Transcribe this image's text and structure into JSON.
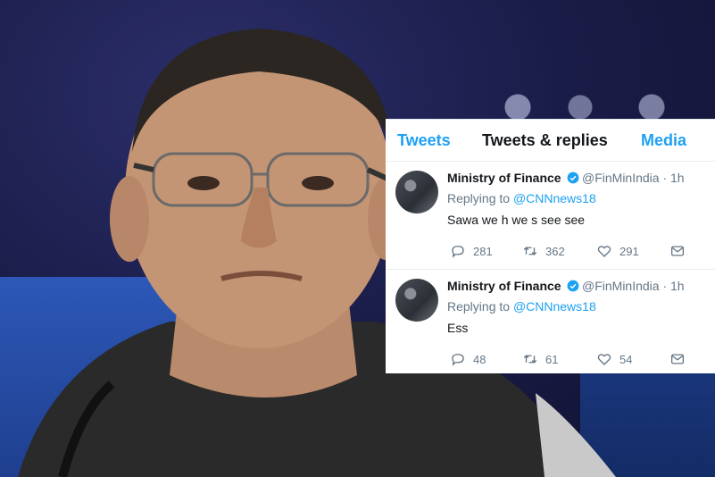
{
  "profile": {
    "tabs": [
      {
        "label": "Tweets"
      },
      {
        "label": "Tweets & replies"
      },
      {
        "label": "Media"
      }
    ],
    "tweets": [
      {
        "author_name": "Ministry of Finance",
        "handle_time": "@FinMinIndia · 1h",
        "replying_prefix": "Replying to",
        "replying_to": "@CNNnews18",
        "text": "Sawa we h we s see see",
        "replies": "281",
        "retweets": "362",
        "likes": "291"
      },
      {
        "author_name": "Ministry of Finance",
        "handle_time": "@FinMinIndia · 1h",
        "replying_prefix": "Replying to",
        "replying_to": "@CNNnews18",
        "text": "Ess",
        "replies": "48",
        "retweets": "61",
        "likes": "54"
      }
    ]
  },
  "colors": {
    "link_blue": "#1da1f2",
    "text_dark": "#14171a",
    "text_muted": "#657786"
  },
  "icons": [
    "verified-badge-icon",
    "reply-icon",
    "retweet-icon",
    "like-icon",
    "direct-message-icon"
  ]
}
